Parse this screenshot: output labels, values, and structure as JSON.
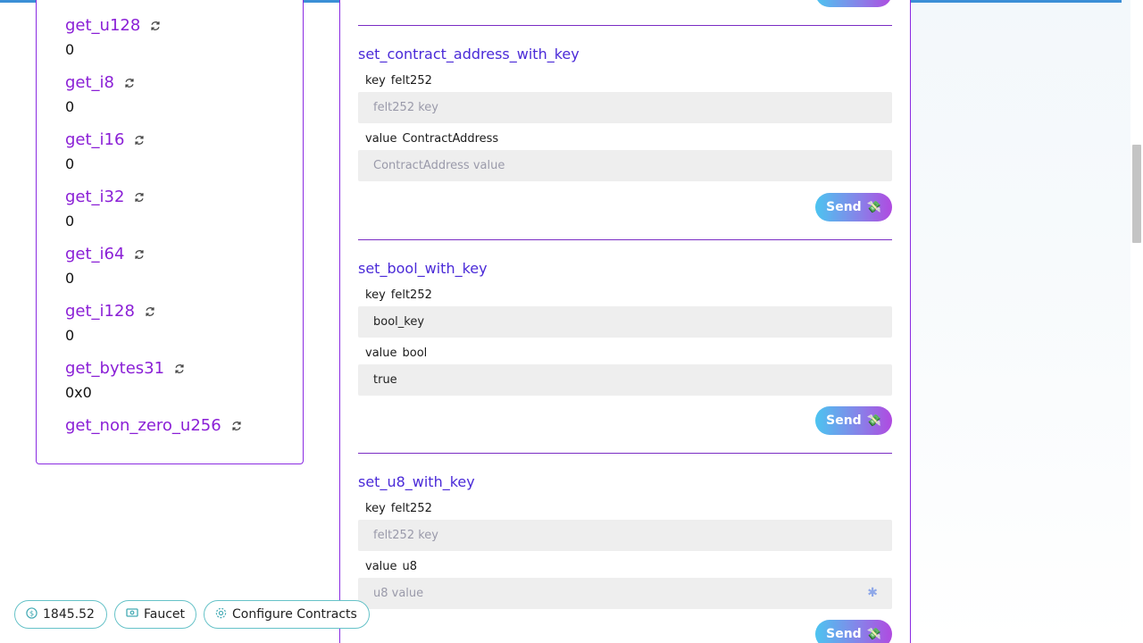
{
  "read_functions": [
    {
      "name": "get_u128",
      "value": "0"
    },
    {
      "name": "get_i8",
      "value": "0"
    },
    {
      "name": "get_i16",
      "value": "0"
    },
    {
      "name": "get_i32",
      "value": "0"
    },
    {
      "name": "get_i64",
      "value": "0"
    },
    {
      "name": "get_i128",
      "value": "0"
    },
    {
      "name": "get_bytes31",
      "value": "0x0"
    },
    {
      "name": "get_non_zero_u256",
      "value": ""
    }
  ],
  "write_functions": [
    {
      "name": "set_contract_address_with_key",
      "params": [
        {
          "name": "key",
          "type": "felt252",
          "value": "",
          "placeholder": "felt252 key"
        },
        {
          "name": "value",
          "type": "ContractAddress",
          "value": "",
          "placeholder": "ContractAddress value"
        }
      ]
    },
    {
      "name": "set_bool_with_key",
      "params": [
        {
          "name": "key",
          "type": "felt252",
          "value": "bool_key",
          "placeholder": ""
        },
        {
          "name": "value",
          "type": "bool",
          "value": "true",
          "placeholder": ""
        }
      ]
    },
    {
      "name": "set_u8_with_key",
      "params": [
        {
          "name": "key",
          "type": "felt252",
          "value": "",
          "placeholder": "felt252 key"
        },
        {
          "name": "value",
          "type": "u8",
          "value": "",
          "placeholder": "u8 value"
        }
      ]
    }
  ],
  "send_label": "Send",
  "send_icon": "money-with-wings-icon",
  "bottom_bar": {
    "balance": "1845.52",
    "faucet_label": "Faucet",
    "configure_label": "Configure Contracts"
  },
  "colors": {
    "accent_purple": "#8a1fd6",
    "title_blue": "#4a2ad8",
    "border": "#8a2be2",
    "pill_border": "#66c2c8"
  }
}
